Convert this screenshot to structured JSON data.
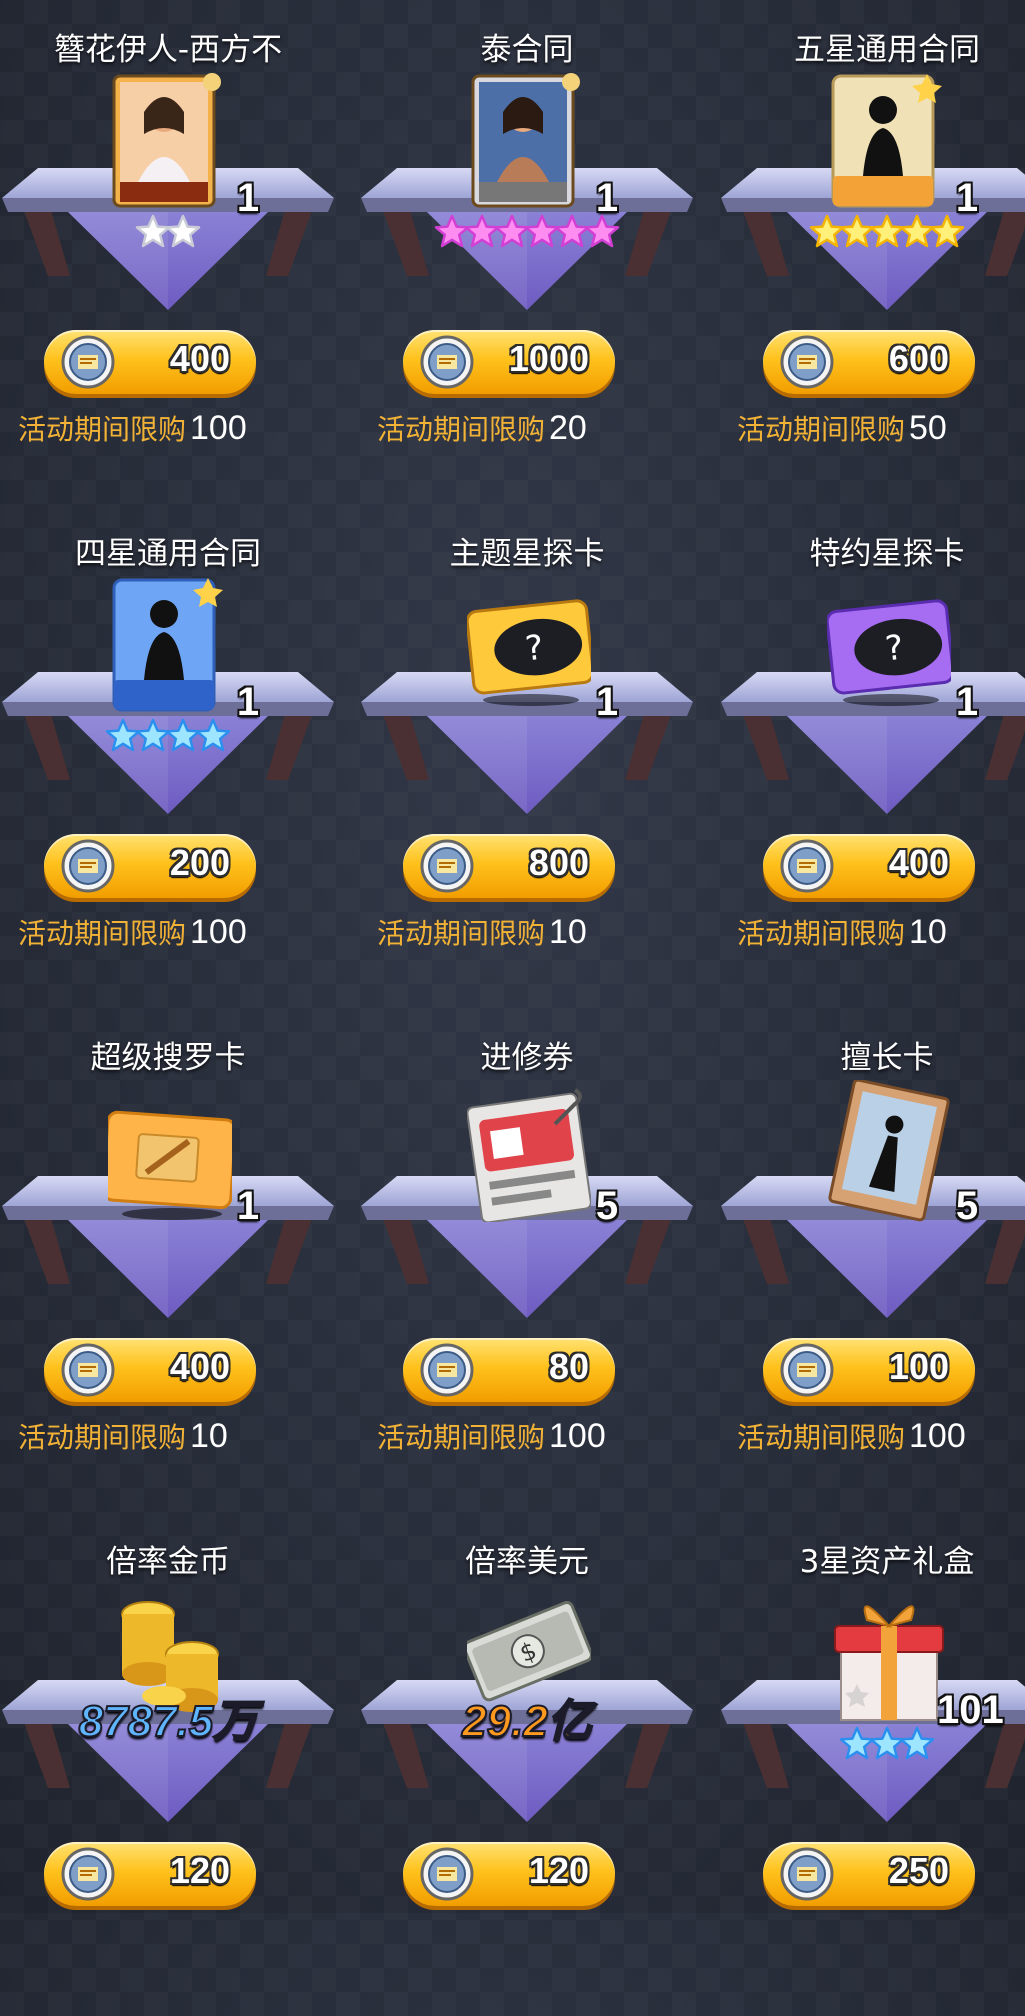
{
  "colors": {
    "accent_gold": "#ffc21d",
    "limit_label": "#f2b236",
    "coin_value_blue": "#5fb6ff",
    "dollar_value_orange": "#ff9a1f"
  },
  "items": [
    {
      "name": "簪花伊人-西方不",
      "icon": "character-card-icon",
      "qty": "1",
      "stars": 2,
      "star_color": "white",
      "price": "400",
      "limit_label": "活动期间限购",
      "limit": "100"
    },
    {
      "name": "泰合同",
      "icon": "character-card-icon",
      "qty": "1",
      "stars": 6,
      "star_color": "pink",
      "price": "1000",
      "limit_label": "活动期间限购",
      "limit": "20"
    },
    {
      "name": "五星通用合同",
      "icon": "silhouette-contract-icon",
      "qty": "1",
      "stars": 5,
      "star_color": "gold",
      "price": "600",
      "limit_label": "活动期间限购",
      "limit": "50"
    },
    {
      "name": "四星通用合同",
      "icon": "silhouette-contract-icon",
      "qty": "1",
      "stars": 4,
      "star_color": "blue",
      "price": "200",
      "limit_label": "活动期间限购",
      "limit": "100"
    },
    {
      "name": "主题星探卡",
      "icon": "mystery-card-icon",
      "qty": "1",
      "stars": 0,
      "star_color": "none",
      "price": "800",
      "limit_label": "活动期间限购",
      "limit": "10"
    },
    {
      "name": "特约星探卡",
      "icon": "mystery-card-icon",
      "qty": "1",
      "stars": 0,
      "star_color": "none",
      "price": "400",
      "limit_label": "活动期间限购",
      "limit": "10"
    },
    {
      "name": "超级搜罗卡",
      "icon": "search-card-icon",
      "qty": "1",
      "stars": 0,
      "star_color": "none",
      "price": "400",
      "limit_label": "活动期间限购",
      "limit": "10"
    },
    {
      "name": "进修券",
      "icon": "training-voucher-icon",
      "qty": "5",
      "stars": 0,
      "star_color": "none",
      "price": "80",
      "limit_label": "活动期间限购",
      "limit": "100"
    },
    {
      "name": "擅长卡",
      "icon": "skill-book-icon",
      "qty": "5",
      "stars": 0,
      "star_color": "none",
      "price": "100",
      "limit_label": "活动期间限购",
      "limit": "100"
    },
    {
      "name": "倍率金币",
      "icon": "gold-coins-icon",
      "qty": "",
      "big_value": "8787.5万",
      "stars": 0,
      "star_color": "none",
      "price": "120"
    },
    {
      "name": "倍率美元",
      "icon": "dollar-bills-icon",
      "qty": "",
      "big_value": "29.2亿",
      "stars": 0,
      "star_color": "none",
      "price": "120"
    },
    {
      "name": "3星资产礼盒",
      "icon": "gift-box-icon",
      "qty": "101",
      "stars": 3,
      "star_color": "blue",
      "price": "250"
    }
  ]
}
